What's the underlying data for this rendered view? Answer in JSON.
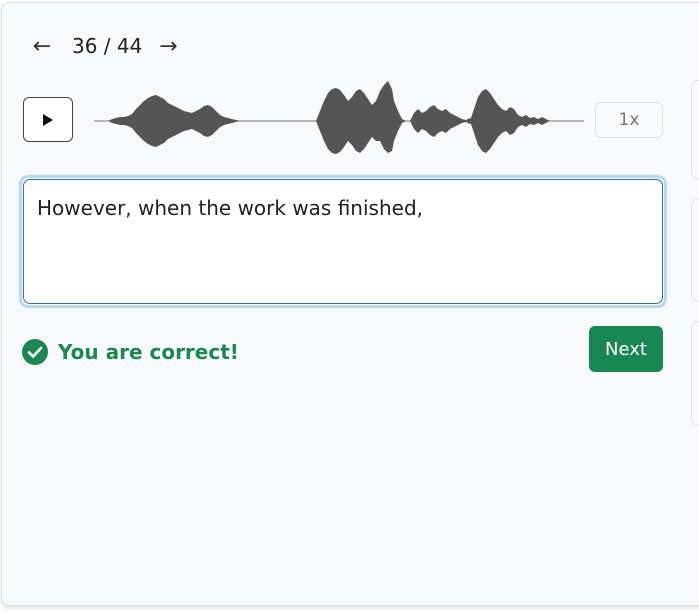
{
  "nav": {
    "prev_icon": "arrow-left-icon",
    "counter": "36 / 44",
    "next_icon": "arrow-right-icon"
  },
  "player": {
    "play_icon": "play-icon",
    "speed_label": "1x"
  },
  "answer": {
    "value": "However, when the work was finished,",
    "placeholder": ""
  },
  "feedback": {
    "icon": "check-circle-icon",
    "text": "You are correct!",
    "color": "#1c8753"
  },
  "actions": {
    "next_label": "Next",
    "next_color": "#198754"
  }
}
